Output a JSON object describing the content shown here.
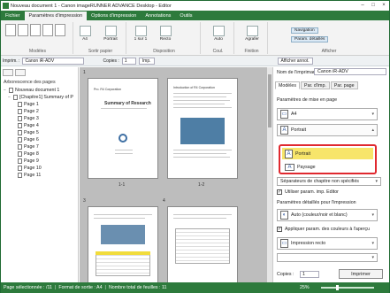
{
  "window": {
    "title": "Nouveau document 1 - Canon imageRUNNER ADVANCE Desktop - Editor",
    "minimize": "–",
    "maximize": "□",
    "close": "×"
  },
  "ribbon_tabs": [
    "Fichier",
    "Paramètres d'impression",
    "Options d'impression",
    "Annotations",
    "Outils"
  ],
  "ribbon": {
    "group_models": "Modèles",
    "group_paper": "Sortir papier",
    "group_layout": "Disposition",
    "group_color": "Coul.",
    "group_finish": "Finition",
    "group_display": "Afficher",
    "paper_size": "A4",
    "orientation": "Portrait",
    "pages_per_sheet": "1 sur 1",
    "sides": "Recto",
    "color": "Auto",
    "staple": "Agrafer",
    "navigation": "Navigation",
    "detail_settings": "Param. détaillés"
  },
  "printer_toolbar": {
    "printer_label": "Imprim. :",
    "printer": "Canon iR-ADV",
    "copies_label": "Copies :",
    "copies": "1",
    "print": "Imp.",
    "show_annotations": "Afficher annot."
  },
  "left_panel": {
    "heading": "Arborescence des pages",
    "items": [
      {
        "label": "Nouveau document 1",
        "level": 0,
        "toggle": "−"
      },
      {
        "label": "[Chapitre1] Summary of P",
        "level": 1,
        "toggle": "−"
      },
      {
        "label": "Page 1",
        "level": 2
      },
      {
        "label": "Page 2",
        "level": 2
      },
      {
        "label": "Page 3",
        "level": 2
      },
      {
        "label": "Page 4",
        "level": 2
      },
      {
        "label": "Page 5",
        "level": 2
      },
      {
        "label": "Page 6",
        "level": 2
      },
      {
        "label": "Page 7",
        "level": 2
      },
      {
        "label": "Page 8",
        "level": 2
      },
      {
        "label": "Page 9",
        "level": 2
      },
      {
        "label": "Page 10",
        "level": 2
      },
      {
        "label": "Page 11",
        "level": 2
      }
    ]
  },
  "preview": {
    "page_numbers": [
      "1",
      "3",
      "4"
    ],
    "sheet_labels": [
      "1-1",
      "1-2"
    ],
    "page1_title": "Summary of Research",
    "page1_head": "Pro. R4 Corporation",
    "page2_head": "Introduction of R4 Corporation"
  },
  "right_panel": {
    "printer_name_label": "Nom de l'imprimante :",
    "printer_name": "Canon iR-ADV",
    "tabs": [
      "Modèles",
      "Par. d'imp.",
      "Par. page"
    ],
    "layout_heading": "Paramètres de mise en page",
    "paper_size": "A4",
    "orientation_current": "Portrait",
    "orientation_options": [
      "Portrait",
      "Paysage"
    ],
    "chapter_separator": "Séparateurs de chapitre non spécifiés",
    "use_editor_settings": "Utiliser param. imp. Editor",
    "detail_heading": "Paramètres détaillés pour l'impression",
    "color_mode": "Auto (couleur/noir et blanc)",
    "apply_preview": "Appliquer param. des couleurs à l'aperçu",
    "duplex": "Impression recto",
    "copies_label": "Copies :",
    "copies": "1",
    "print": "Imprimer"
  },
  "status": {
    "selected": "Page sélectionnée : /11",
    "format": "Format de sortie : A4",
    "sheets": "Nombre total de feuilles : 11",
    "zoom": "25%"
  },
  "colors": {
    "accent": "#2d7a3c",
    "highlight": "#f7e56a",
    "callout": "#e0292f"
  }
}
